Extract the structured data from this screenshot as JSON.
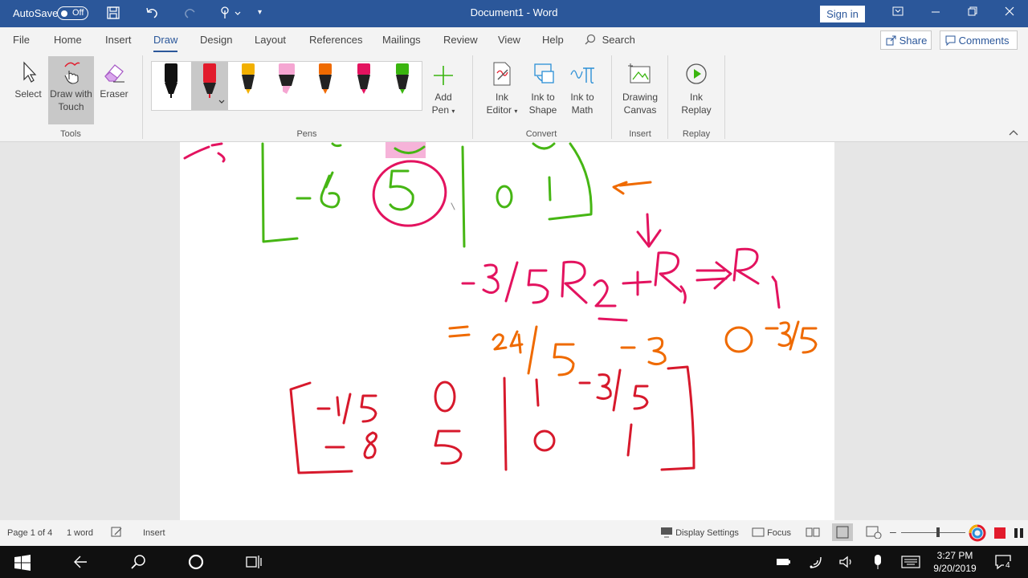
{
  "titlebar": {
    "autosave_label": "AutoSave",
    "autosave_state": "Off",
    "doc_title": "Document1  -  Word",
    "signin": "Sign in"
  },
  "tabs": [
    "File",
    "Home",
    "Insert",
    "Draw",
    "Design",
    "Layout",
    "References",
    "Mailings",
    "Review",
    "View",
    "Help"
  ],
  "active_tab": "Draw",
  "search_label": "Search",
  "share_label": "Share",
  "comments_label": "Comments",
  "ribbon": {
    "tools": {
      "select": "Select",
      "draw_touch_1": "Draw with",
      "draw_touch_2": "Touch",
      "eraser": "Eraser",
      "group": "Tools"
    },
    "pens_group": "Pens",
    "pen_colors": [
      "#111111",
      "#e21b2c",
      "#f2b000",
      "#f5a6d2",
      "#ef6a00",
      "#e3135f",
      "#3ab50f"
    ],
    "add_pen_1": "Add",
    "add_pen_2": "Pen",
    "convert": {
      "ink_editor_1": "Ink",
      "ink_editor_2": "Editor",
      "ink_shape_1": "Ink to",
      "ink_shape_2": "Shape",
      "ink_math_1": "Ink to",
      "ink_math_2": "Math",
      "group": "Convert"
    },
    "insert": {
      "canvas_1": "Drawing",
      "canvas_2": "Canvas",
      "group": "Insert"
    },
    "replay": {
      "ink_replay_1": "Ink",
      "ink_replay_2": "Replay",
      "group": "Replay"
    }
  },
  "ink_colors": {
    "green": "#46b614",
    "magenta": "#e3135f",
    "orange": "#ef6a00",
    "red": "#d7192c",
    "pink_highlight": "#f5a6d2"
  },
  "ink_text": {
    "rowop": "−3/5R₂ + R₁ ⇒ R₁"
  },
  "statusbar": {
    "page": "Page 1 of 4",
    "words": "1 word",
    "mode": "Insert",
    "display_settings": "Display Settings",
    "focus": "Focus"
  },
  "taskbar": {
    "time": "3:27 PM",
    "date": "9/20/2019",
    "notifications": "4"
  }
}
